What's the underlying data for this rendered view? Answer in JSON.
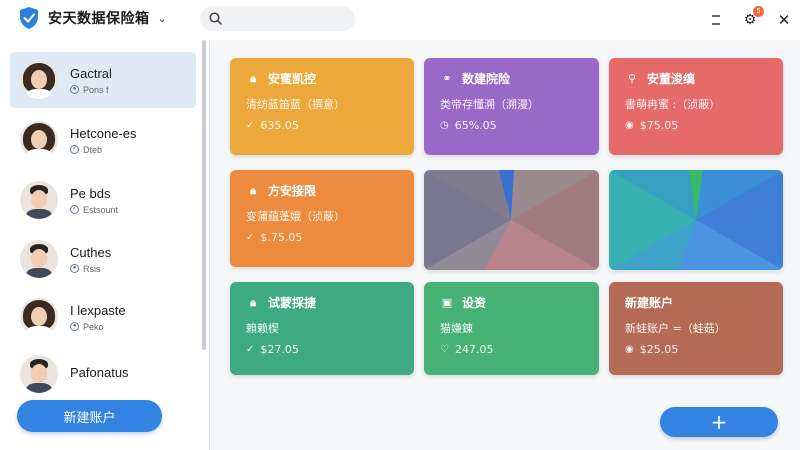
{
  "app": {
    "title": "安天数据保险箱"
  },
  "search": {
    "placeholder": ""
  },
  "window": {
    "notification_count": "5"
  },
  "sidebar": {
    "accounts": [
      {
        "name": "Gactral",
        "status": "Pons f",
        "gender": "female",
        "active": true
      },
      {
        "name": "Hetcone-es",
        "status": "Dteb",
        "gender": "female",
        "active": false
      },
      {
        "name": "Pe bds",
        "status": "Estsount",
        "gender": "male",
        "active": false
      },
      {
        "name": "Cuthes",
        "status": "Rsis",
        "gender": "male",
        "active": false
      },
      {
        "name": "I lexpaste",
        "status": "Peko",
        "gender": "female",
        "active": false
      },
      {
        "name": "Pafonatus",
        "status": "",
        "gender": "male",
        "active": false
      }
    ],
    "new_account_label": "新建账户"
  },
  "cards": [
    {
      "title": "安蜜凯控",
      "subtitle": "清纺蓝笛蓝（撰意）",
      "value": "635.05",
      "color": "#eca83a",
      "icon": "lock-icon"
    },
    {
      "title": "数建院险",
      "subtitle": "类帝存懂溯（溯漫）",
      "value": "65%.05",
      "color": "#9a68c6",
      "icon": "link-icon"
    },
    {
      "title": "安董浚缡",
      "subtitle": "書萌冉蜜 :（浈蔽）",
      "value": "$75.05",
      "color": "#e56a69",
      "icon": "key-icon"
    },
    {
      "title": "方安接限",
      "subtitle": "变蒲蕴蓬娥（浈蔽）",
      "value": "$.75.05",
      "color": "#ec8b3e",
      "icon": "lock-icon"
    },
    {
      "title": "试蒙採捷",
      "subtitle": "賴赖楔",
      "value": "$27.05",
      "color": "#3daa84",
      "icon": "lock-icon"
    },
    {
      "title": "设资",
      "subtitle": "猫嫌錬",
      "value": "247.05",
      "color": "#46b276",
      "icon": "folder-icon"
    },
    {
      "title": "新建账户",
      "subtitle": "新蛙账户 =（蛙菇）",
      "value": "$25.05",
      "color": "#b46a54",
      "icon": ""
    }
  ]
}
